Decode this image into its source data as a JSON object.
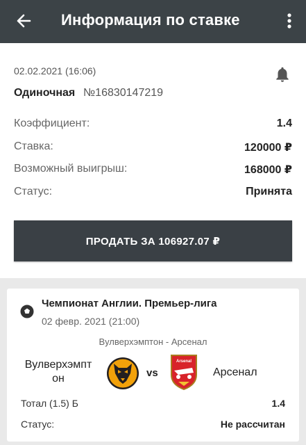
{
  "header": {
    "title": "Информация по ставке",
    "back_icon": "arrow-left-icon",
    "menu_icon": "more-vert-icon"
  },
  "bet": {
    "datetime": "02.02.2021 (16:06)",
    "type": "Одиночная",
    "number": "№16830147219",
    "rows": [
      {
        "label": "Коэффициент:",
        "value": "1.4"
      },
      {
        "label": "Ставка:",
        "value": "120000 ₽"
      },
      {
        "label": "Возможный выигрыш:",
        "value": "168000 ₽"
      },
      {
        "label": "Статус:",
        "value": "Принята"
      }
    ],
    "sell_label": "ПРОДАТЬ ЗА 106927.07 ₽"
  },
  "event": {
    "league": "Чемпионат Англии. Премьер-лига",
    "date": "02 февр. 2021 (21:00)",
    "match": "Вулверхэмптон - Арсенал",
    "team1": "Вулверхэмпт он",
    "vs": "vs",
    "team2": "Арсенал",
    "market_label": "Тотал (1.5) Б",
    "market_value": "1.4",
    "status_label": "Статус:",
    "status_value": "Не рассчитан"
  },
  "colors": {
    "header_bg": "#3c4347",
    "sell_button_bg": "#3a4045",
    "page_bg": "#e9e9e9",
    "wolves_orange": "#f2a10a",
    "arsenal_red": "#d8232a"
  }
}
